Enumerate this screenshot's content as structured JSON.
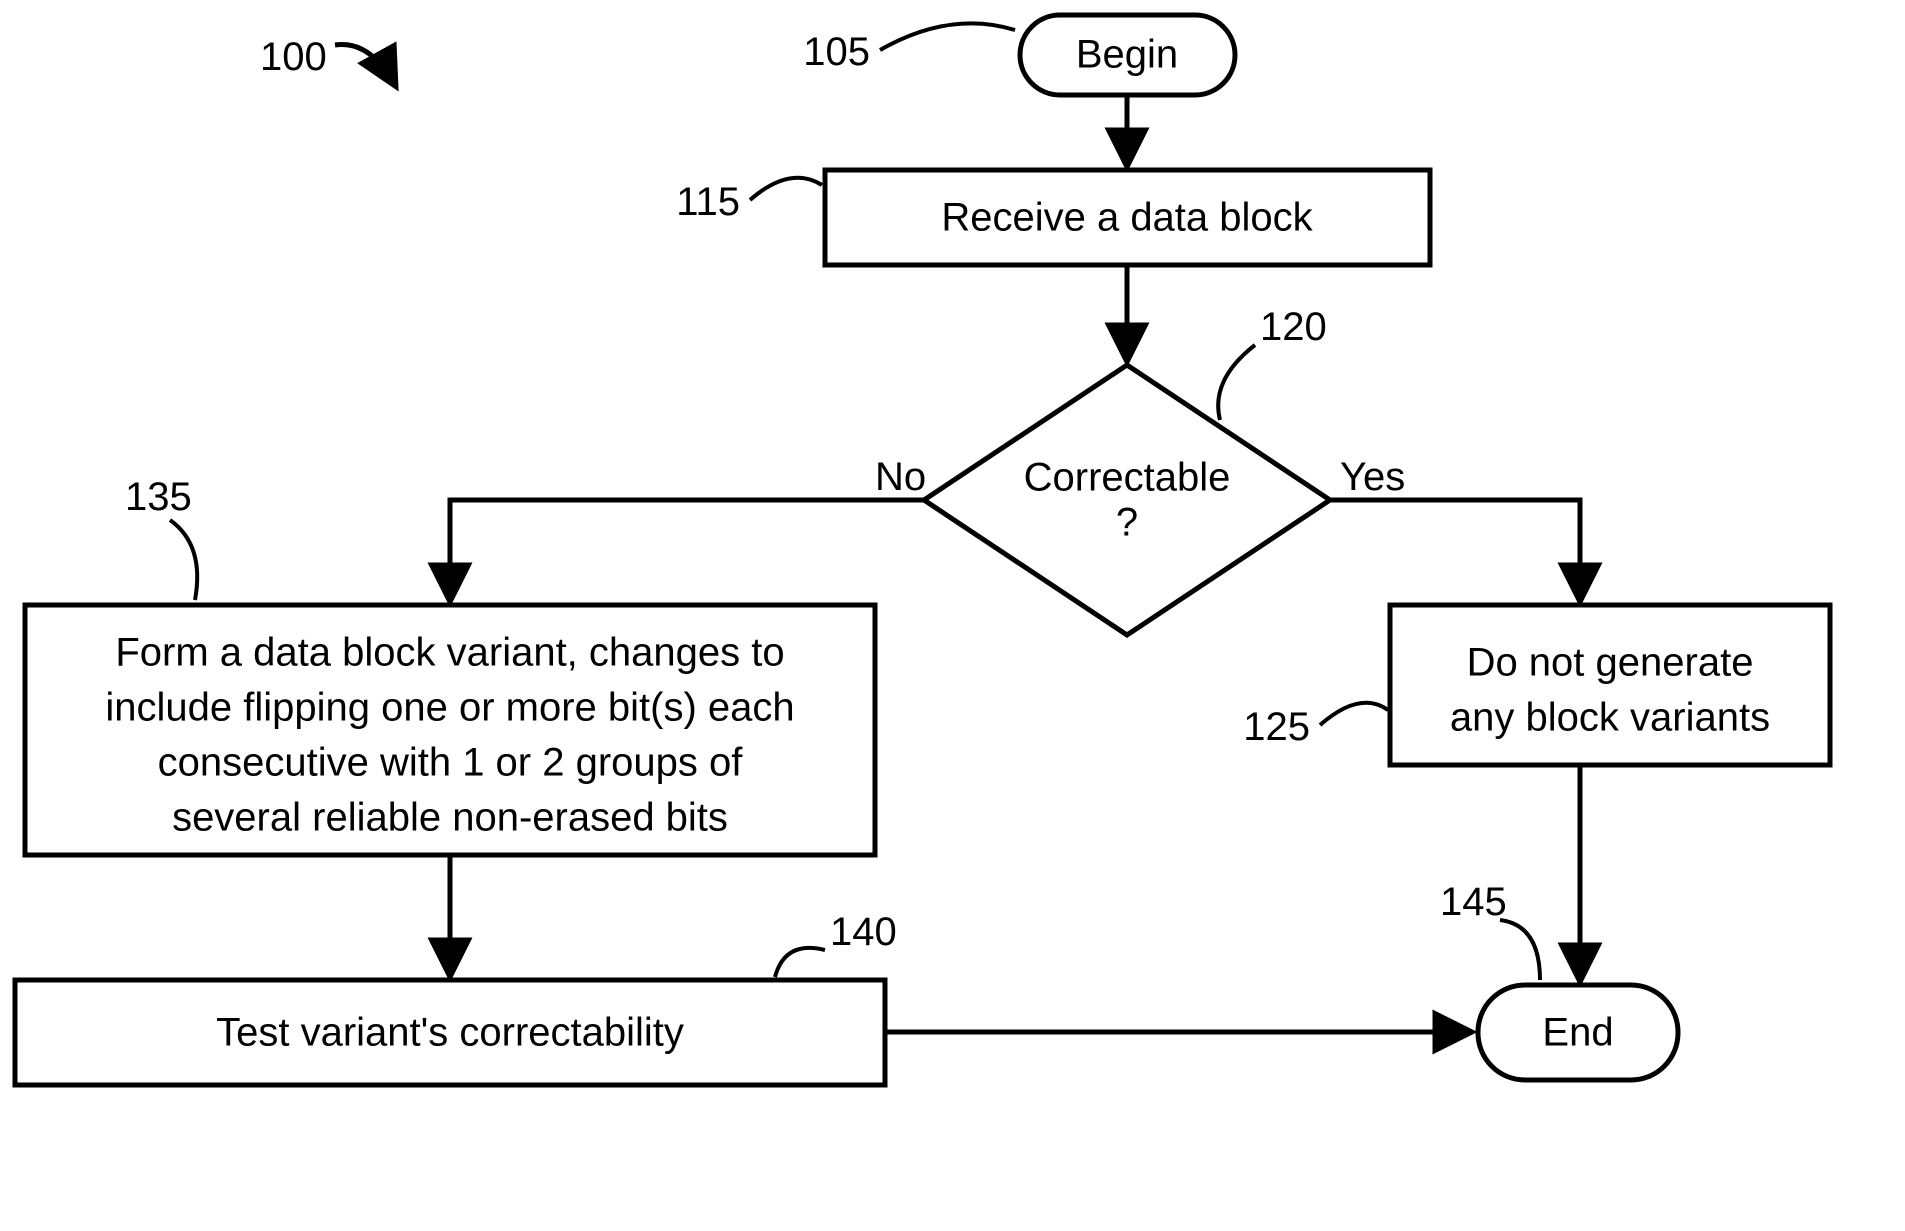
{
  "refs": {
    "fig": "100",
    "begin": "105",
    "receive": "115",
    "decision": "120",
    "noVariants": "125",
    "form": "135",
    "test": "140",
    "end": "145"
  },
  "labels": {
    "begin": "Begin",
    "receive": "Receive a data block",
    "decision1": "Correctable",
    "decision2": "?",
    "no": "No",
    "yes": "Yes",
    "noVariants1": "Do not generate",
    "noVariants2": "any block variants",
    "form1": "Form a data block variant, changes to",
    "form2": "include flipping one or more bit(s) each",
    "form3": "consecutive with 1 or 2 groups of",
    "form4": "several reliable non-erased bits",
    "test": "Test variant's correctability",
    "end": "End"
  }
}
